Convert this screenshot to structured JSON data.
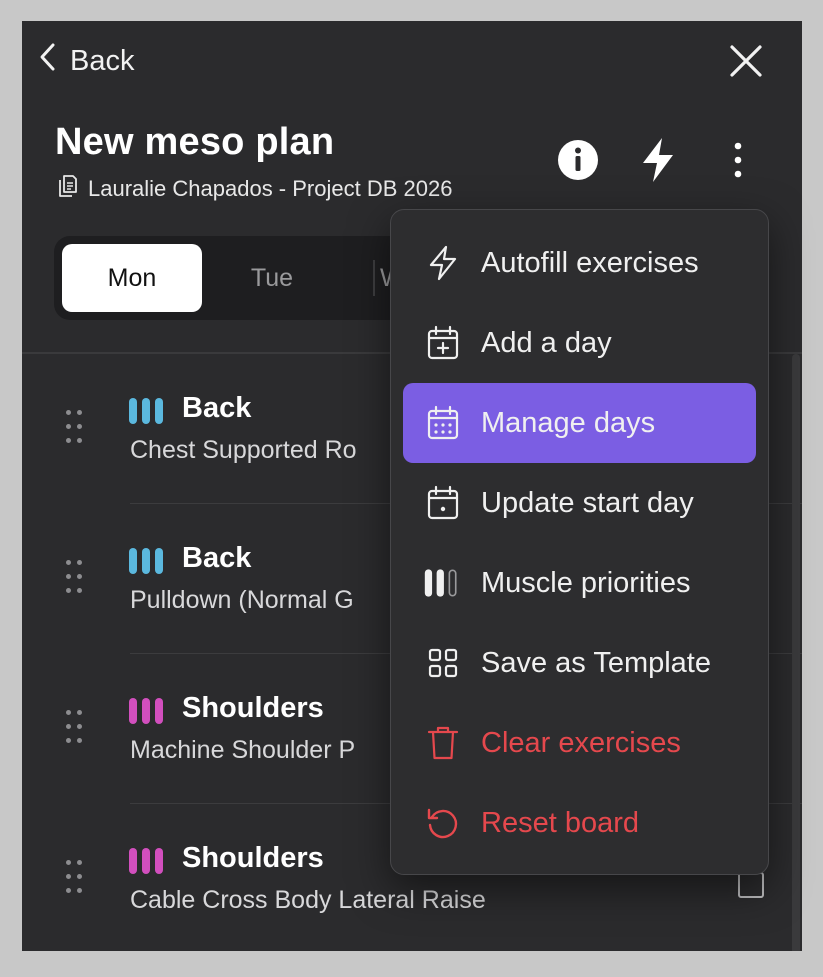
{
  "topbar": {
    "back_label": "Back"
  },
  "header": {
    "title": "New meso plan",
    "subtitle": "Lauralie Chapados - Project DB 2026"
  },
  "days": [
    {
      "label": "Mon",
      "active": true
    },
    {
      "label": "Tue",
      "active": false
    },
    {
      "label": "W",
      "active": false
    }
  ],
  "exercises": [
    {
      "muscle": "Back",
      "exercise": "Chest Supported Ro",
      "color": "#5bb8de"
    },
    {
      "muscle": "Back",
      "exercise": "Pulldown (Normal G",
      "color": "#5bb8de"
    },
    {
      "muscle": "Shoulders",
      "exercise": "Machine Shoulder P",
      "color": "#d24fbe"
    },
    {
      "muscle": "Shoulders",
      "exercise": "Cable Cross Body Lateral Raise",
      "color": "#d24fbe"
    }
  ],
  "menu": {
    "items": [
      {
        "label": "Autofill exercises",
        "icon": "lightning-icon",
        "danger": false
      },
      {
        "label": "Add a day",
        "icon": "calendar-plus-icon",
        "danger": false
      },
      {
        "label": "Manage days",
        "icon": "calendar-grid-icon",
        "danger": false,
        "active": true
      },
      {
        "label": "Update start day",
        "icon": "calendar-dot-icon",
        "danger": false
      },
      {
        "label": "Muscle priorities",
        "icon": "priority-bars-icon",
        "danger": false
      },
      {
        "label": "Save as Template",
        "icon": "grid-icon",
        "danger": false
      },
      {
        "label": "Clear exercises",
        "icon": "trash-icon",
        "danger": true
      },
      {
        "label": "Reset board",
        "icon": "reset-icon",
        "danger": true
      }
    ]
  },
  "colors": {
    "accent": "#7b5ee3",
    "danger": "#e5484d",
    "back_muscle": "#5bb8de",
    "shoulders_muscle": "#d24fbe"
  }
}
